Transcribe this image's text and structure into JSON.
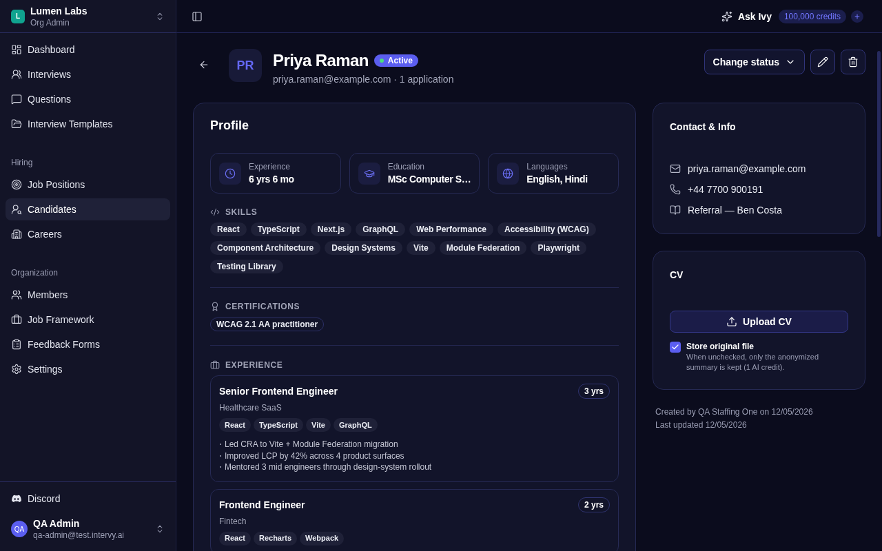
{
  "sidebar": {
    "org": {
      "initial": "L",
      "name": "Lumen Labs",
      "role": "Org Admin"
    },
    "nav": [
      {
        "items": [
          {
            "label": "Dashboard",
            "selected": false
          },
          {
            "label": "Interviews",
            "selected": false
          },
          {
            "label": "Questions",
            "selected": false
          },
          {
            "label": "Interview Templates",
            "selected": false
          }
        ]
      },
      {
        "heading": "Hiring",
        "items": [
          {
            "label": "Job Positions",
            "selected": false
          },
          {
            "label": "Candidates",
            "selected": true
          },
          {
            "label": "Careers",
            "selected": false
          }
        ]
      },
      {
        "heading": "Organization",
        "items": [
          {
            "label": "Members",
            "selected": false
          },
          {
            "label": "Job Framework",
            "selected": false
          },
          {
            "label": "Feedback Forms",
            "selected": false
          },
          {
            "label": "Settings",
            "selected": false
          }
        ]
      }
    ],
    "community": {
      "label": "Discord"
    },
    "user": {
      "initials": "QA",
      "name": "QA Admin",
      "email": "qa-admin@test.intervy.ai"
    }
  },
  "top_bar": {
    "assistant": "Ask Ivy",
    "credits": "100,000 credits"
  },
  "candidate": {
    "initials": "PR",
    "name": "Priya Raman",
    "status": "Active",
    "subtitle": "priya.raman@example.com · 1 application",
    "actions": {
      "change_status": "Change status"
    }
  },
  "profile": {
    "title": "Profile",
    "stats": [
      {
        "label": "Experience",
        "value": "6 yrs 6 mo"
      },
      {
        "label": "Education",
        "value": "MSc Computer S…"
      },
      {
        "label": "Languages",
        "value": "English, Hindi"
      }
    ],
    "skills": {
      "heading": "SKILLS",
      "items": [
        "React",
        "TypeScript",
        "Next.js",
        "GraphQL",
        "Web Performance",
        "Accessibility (WCAG)",
        "Component Architecture",
        "Design Systems",
        "Vite",
        "Module Federation",
        "Playwright",
        "Testing Library"
      ]
    },
    "certifications": {
      "heading": "CERTIFICATIONS",
      "items": [
        "WCAG 2.1 AA practitioner"
      ]
    },
    "experience": {
      "heading": "EXPERIENCE",
      "jobs": [
        {
          "title": "Senior Frontend Engineer",
          "duration": "3 yrs",
          "company": "Healthcare SaaS",
          "skills": [
            "React",
            "TypeScript",
            "Vite",
            "GraphQL"
          ],
          "highlights": [
            "Led CRA to Vite + Module Federation migration",
            "Improved LCP by 42% across 4 product surfaces",
            "Mentored 3 mid engineers through design-system rollout"
          ]
        },
        {
          "title": "Frontend Engineer",
          "duration": "2 yrs",
          "company": "Fintech",
          "skills": [
            "React",
            "Recharts",
            "Webpack"
          ]
        }
      ]
    }
  },
  "contact": {
    "title": "Contact & Info",
    "rows": [
      "priya.raman@example.com",
      "+44 7700 900191",
      "Referral — Ben Costa"
    ]
  },
  "cv": {
    "title": "CV",
    "upload": "Upload CV",
    "store": {
      "label": "Store original file",
      "checked": true,
      "hint": "When unchecked, only the anonymized summary is kept (1 AI credit)."
    }
  },
  "meta": [
    "Created by QA Staffing One on 12/05/2026",
    "Last updated 12/05/2026"
  ]
}
